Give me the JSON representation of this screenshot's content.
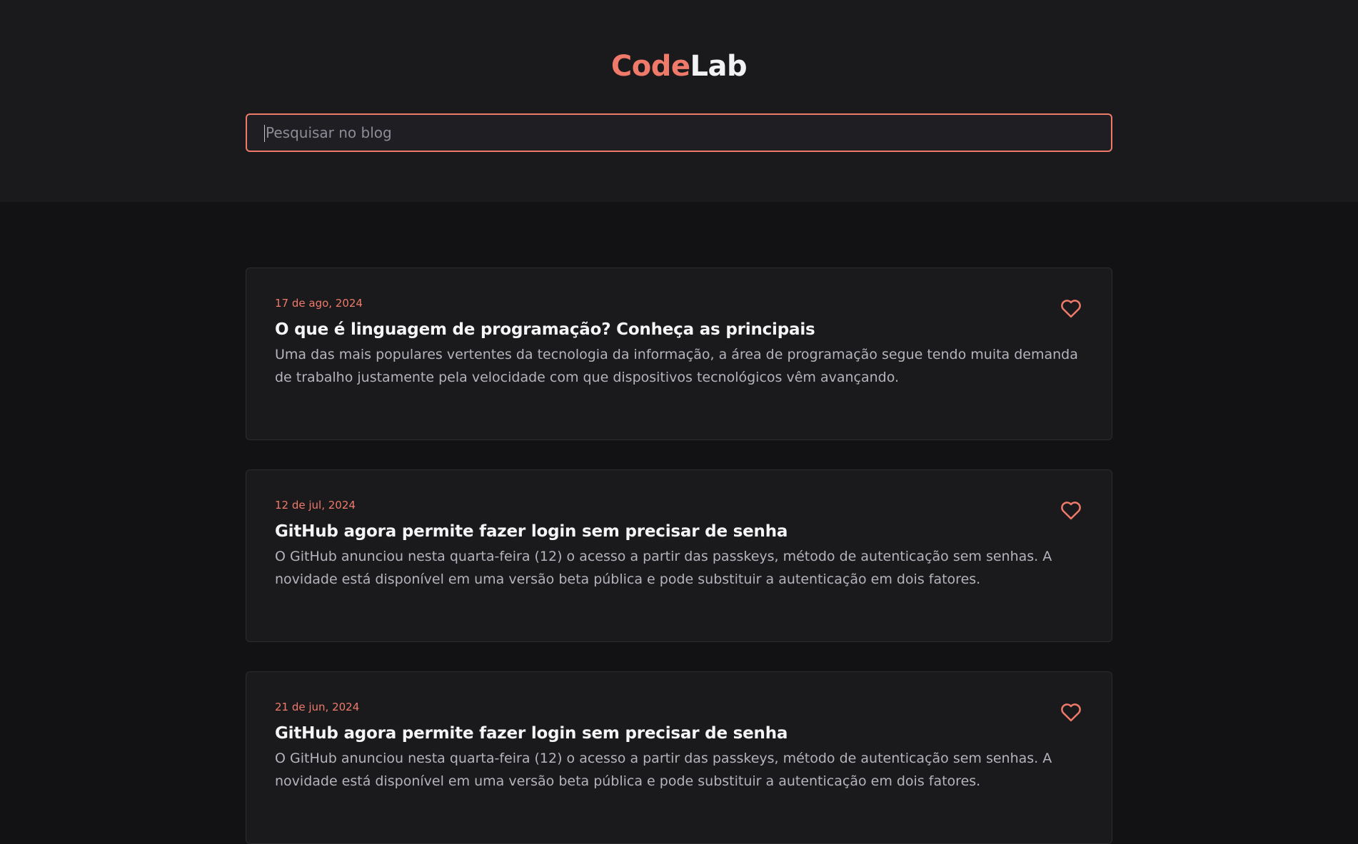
{
  "header": {
    "logo_part1": "Code",
    "logo_part2": "Lab",
    "search_placeholder": "Pesquisar no blog"
  },
  "posts": [
    {
      "date": "17 de ago, 2024",
      "title": "O que é linguagem de programação? Conheça as principais",
      "excerpt": "Uma das mais populares vertentes da tecnologia da informação, a área de programação segue tendo muita demanda de trabalho justamente pela velocidade com que dispositivos tecnológicos vêm avançando."
    },
    {
      "date": "12 de jul, 2024",
      "title": "GitHub agora permite fazer login sem precisar de senha",
      "excerpt": "O GitHub anunciou nesta quarta-feira (12) o acesso a partir das passkeys, método de autenticação sem senhas. A novidade está disponível em uma versão beta pública e pode substituir a autenticação em dois fatores."
    },
    {
      "date": "21 de jun, 2024",
      "title": "GitHub agora permite fazer login sem precisar de senha",
      "excerpt": "O GitHub anunciou nesta quarta-feira (12) o acesso a partir das passkeys, método de autenticação sem senhas. A novidade está disponível em uma versão beta pública e pode substituir a autenticação em dois fatores."
    }
  ],
  "colors": {
    "accent": "#ef7a6a",
    "background": "#121214",
    "card": "#1a1a1d"
  },
  "icons": {
    "like": "heart-icon"
  }
}
